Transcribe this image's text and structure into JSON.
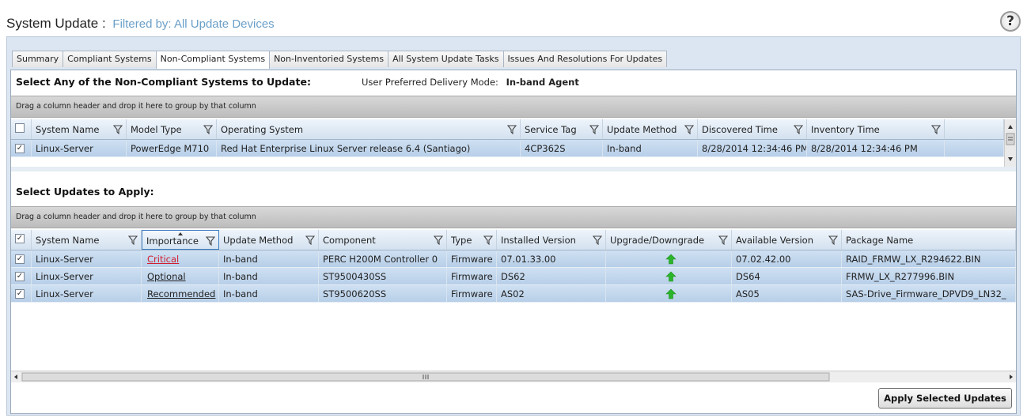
{
  "header": {
    "title": "System Update :",
    "filter": "Filtered by: All Update Devices",
    "help_glyph": "?"
  },
  "tabs": [
    {
      "label": "Summary",
      "active": false
    },
    {
      "label": "Compliant Systems",
      "active": false
    },
    {
      "label": "Non-Compliant Systems",
      "active": true
    },
    {
      "label": "Non-Inventoried Systems",
      "active": false
    },
    {
      "label": "All System Update Tasks",
      "active": false
    },
    {
      "label": "Issues And Resolutions For Updates",
      "active": false
    }
  ],
  "systems_section": {
    "title": "Select Any of the Non-Compliant Systems to Update:",
    "delivery_label": "User Preferred Delivery Mode:",
    "delivery_value": "In-band Agent",
    "group_hint": "Drag a column header and drop it here to group by that column",
    "columns": [
      "System Name",
      "Model Type",
      "Operating System",
      "Service Tag",
      "Update Method",
      "Discovered Time",
      "Inventory Time"
    ],
    "rows": [
      {
        "checked": true,
        "system_name": "Linux-Server",
        "model_type": "PowerEdge M710",
        "operating_system": "Red Hat Enterprise Linux Server release 6.4 (Santiago)",
        "service_tag": "4CP362S",
        "update_method": "In-band",
        "discovered_time": "8/28/2014 12:34:46 PM",
        "inventory_time": "8/28/2014 12:34:46 PM"
      }
    ]
  },
  "updates_section": {
    "title": "Select Updates to Apply:",
    "group_hint": "Drag a column header and drop it here to group by that column",
    "columns": [
      "System Name",
      "Importance",
      "Update Method",
      "Component",
      "Type",
      "Installed Version",
      "Upgrade/Downgrade",
      "Available Version",
      "Package Name"
    ],
    "rows": [
      {
        "checked": true,
        "system_name": "Linux-Server",
        "importance": "Critical",
        "update_method": "In-band",
        "component": "PERC H200M Controller 0",
        "type": "Firmware",
        "installed_version": "07.01.33.00",
        "direction": "upgrade",
        "available_version": "07.02.42.00",
        "package_name": "RAID_FRMW_LX_R294622.BIN"
      },
      {
        "checked": true,
        "system_name": "Linux-Server",
        "importance": "Optional",
        "update_method": "In-band",
        "component": "ST9500430SS",
        "type": "Firmware",
        "installed_version": "DS62",
        "direction": "upgrade",
        "available_version": "DS64",
        "package_name": "FRMW_LX_R277996.BIN"
      },
      {
        "checked": true,
        "system_name": "Linux-Server",
        "importance": "Recommended",
        "update_method": "In-band",
        "component": "ST9500620SS",
        "type": "Firmware",
        "installed_version": "AS02",
        "direction": "upgrade",
        "available_version": "AS05",
        "package_name": "SAS-Drive_Firmware_DPVD9_LN32_"
      }
    ]
  },
  "apply_button_label": "Apply Selected Updates",
  "colors": {
    "filter_text": "#6a9fc8",
    "critical": "#d02030",
    "upgrade_arrow": "#2bb52b",
    "row_selected": "#bcd3ea"
  }
}
